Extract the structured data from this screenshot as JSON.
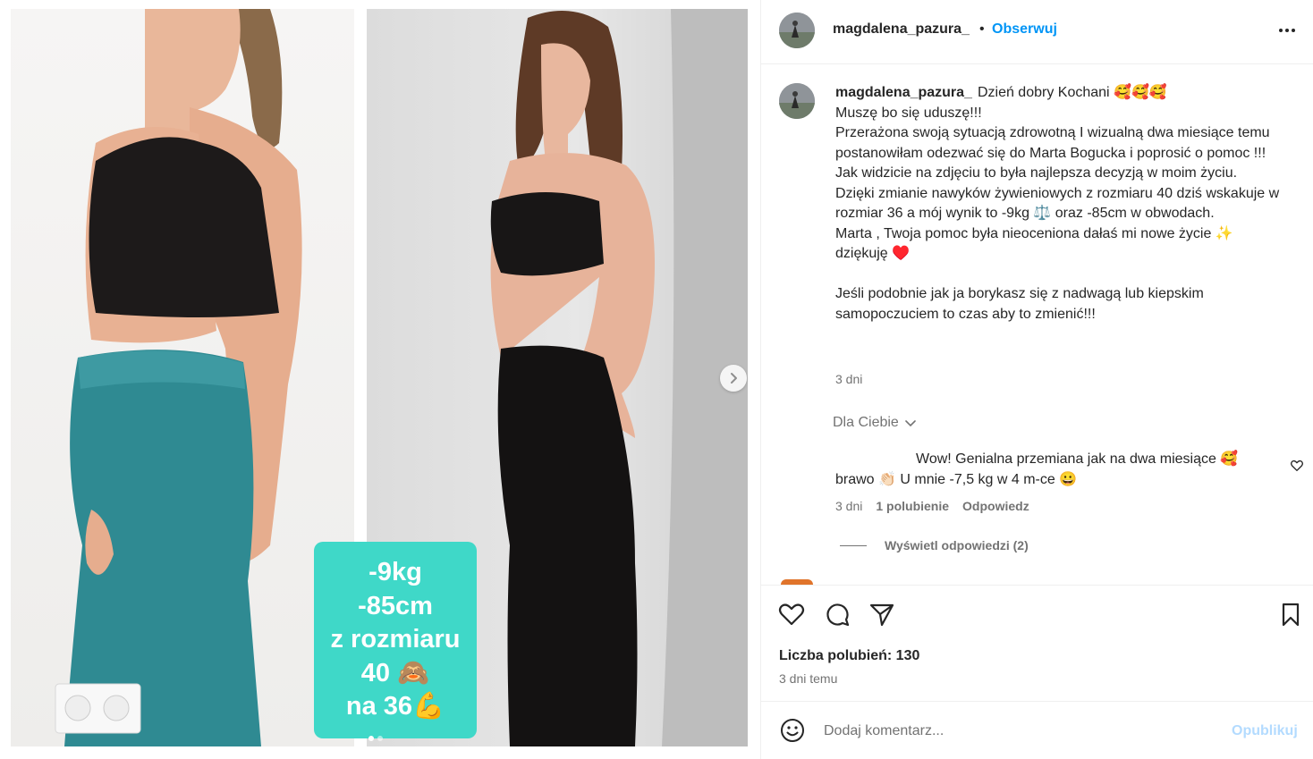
{
  "post": {
    "overlay_lines": [
      "-9kg",
      "-85cm",
      "z rozmiaru",
      "40 🙈",
      "na 36💪"
    ],
    "carousel_dots": 2,
    "carousel_active": 0
  },
  "header": {
    "username": "magdalena_pazura_",
    "separator": "•",
    "follow_label": "Obserwuj",
    "more_icon": "more-horizontal-icon"
  },
  "caption": {
    "username": "magdalena_pazura_",
    "lines": [
      "Dzień dobry Kochani 🥰🥰🥰",
      "Muszę bo się uduszę!!!",
      "Przerażona swoją sytuacją zdrowotną I wizualną dwa miesiące temu postanowiłam odezwać się do Marta Bogucka i poprosić o pomoc !!!",
      "Jak widzicie na zdjęciu to była najlepsza decyzją w moim życiu.",
      "Dzięki zmianie nawyków żywieniowych z rozmiaru 40 dziś wskakuje w rozmiar 36 a mój wynik to -9kg ⚖️ oraz -85cm w obwodach.",
      "Marta , Twoja pomoc była nieoceniona dałaś mi nowe życie ✨ dziękuję ♥️",
      "",
      "Jeśli podobnie jak ja borykasz się z nadwagą lub kiepskim samopoczuciem to czas aby to zmienić!!!"
    ],
    "time": "3 dni"
  },
  "for_you": {
    "label": "Dla Ciebie"
  },
  "comment": {
    "text": "Wow! Genialna przemiana jak na dwa miesiące 🥰 brawo 👏🏻 U mnie -7,5 kg w 4 m-ce 😀",
    "time": "3 dni",
    "likes": "1 polubienie",
    "reply_label": "Odpowiedz",
    "view_replies": "Wyświetl odpowiedzi (2)"
  },
  "actions": {
    "likes_text": "Liczba polubień: 130",
    "post_time": "3 dni temu"
  },
  "comment_box": {
    "placeholder": "Dodaj komentarz...",
    "publish_label": "Opublikuj"
  },
  "colors": {
    "accent": "#0095f6",
    "overlay": "#3fd8c8",
    "publish_disabled": "#b3dbff",
    "secondary_text": "#737373"
  }
}
